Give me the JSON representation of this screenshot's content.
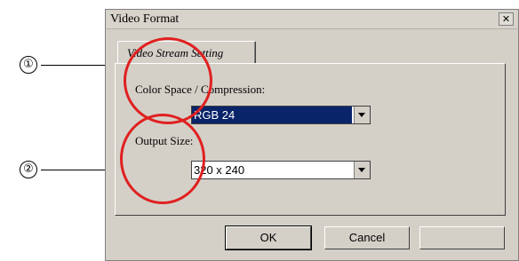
{
  "window": {
    "title": "Video Format",
    "close_glyph": "✕"
  },
  "tabs": [
    {
      "label": "Video Stream Setting"
    }
  ],
  "color_space": {
    "label": "Color Space / Compression:",
    "value": "RGB 24"
  },
  "output_size": {
    "label": "Output Size:",
    "value": "320 x 240"
  },
  "buttons": {
    "ok": "OK",
    "cancel": "Cancel",
    "third": ""
  },
  "callouts": [
    {
      "number": "①"
    },
    {
      "number": "②"
    }
  ],
  "colors": {
    "highlight_circle": "#e02020",
    "selection": "#0a246a",
    "dialog_bg": "#d4d0c8"
  }
}
